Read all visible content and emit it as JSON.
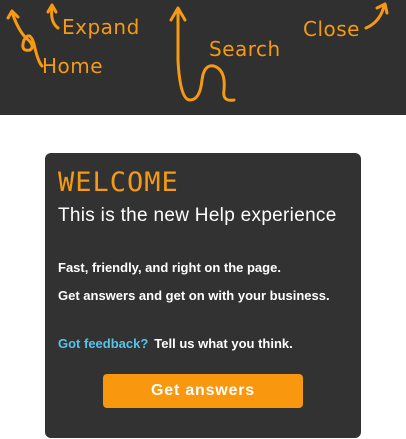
{
  "guide": {
    "expand_label": "Expand",
    "home_label": "Home",
    "search_label": "Search",
    "close_label": "Close"
  },
  "welcome": {
    "heading": "WELCOME",
    "headline": "This is the new Help experience",
    "line1": "Fast, friendly, and right on the page.",
    "line2": "Get answers and get on with your business.",
    "feedback_link": "Got feedback?",
    "feedback_text": "Tell us what you think.",
    "cta_label": "Get answers"
  },
  "colors": {
    "band": "#303030",
    "card": "#323232",
    "accent": "#f59a12",
    "link": "#57c3e8"
  },
  "icons": [
    "home-arrow-icon",
    "expand-arrow-icon",
    "search-arrow-icon",
    "close-arrow-icon"
  ]
}
